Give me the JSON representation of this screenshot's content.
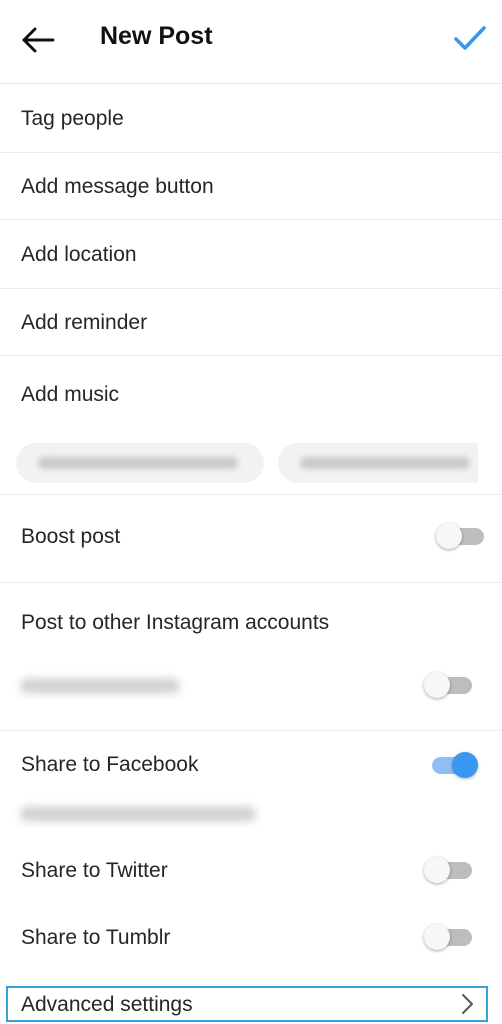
{
  "header": {
    "title": "New Post",
    "back_icon": "arrow-left-icon",
    "confirm_icon": "checkmark-icon",
    "accent_color": "#3897f0"
  },
  "options": {
    "tag_people": "Tag people",
    "add_message_button": "Add message button",
    "add_location": "Add location",
    "add_reminder": "Add reminder",
    "add_music": "Add music"
  },
  "boost": {
    "label": "Boost post",
    "enabled": false
  },
  "other_accounts": {
    "title": "Post to other Instagram accounts",
    "account_enabled": false
  },
  "share": {
    "facebook": {
      "label": "Share to Facebook",
      "enabled": true
    },
    "twitter": {
      "label": "Share to Twitter",
      "enabled": false
    },
    "tumblr": {
      "label": "Share to Tumblr",
      "enabled": false
    }
  },
  "advanced": {
    "label": "Advanced settings",
    "icon": "chevron-right-icon"
  }
}
